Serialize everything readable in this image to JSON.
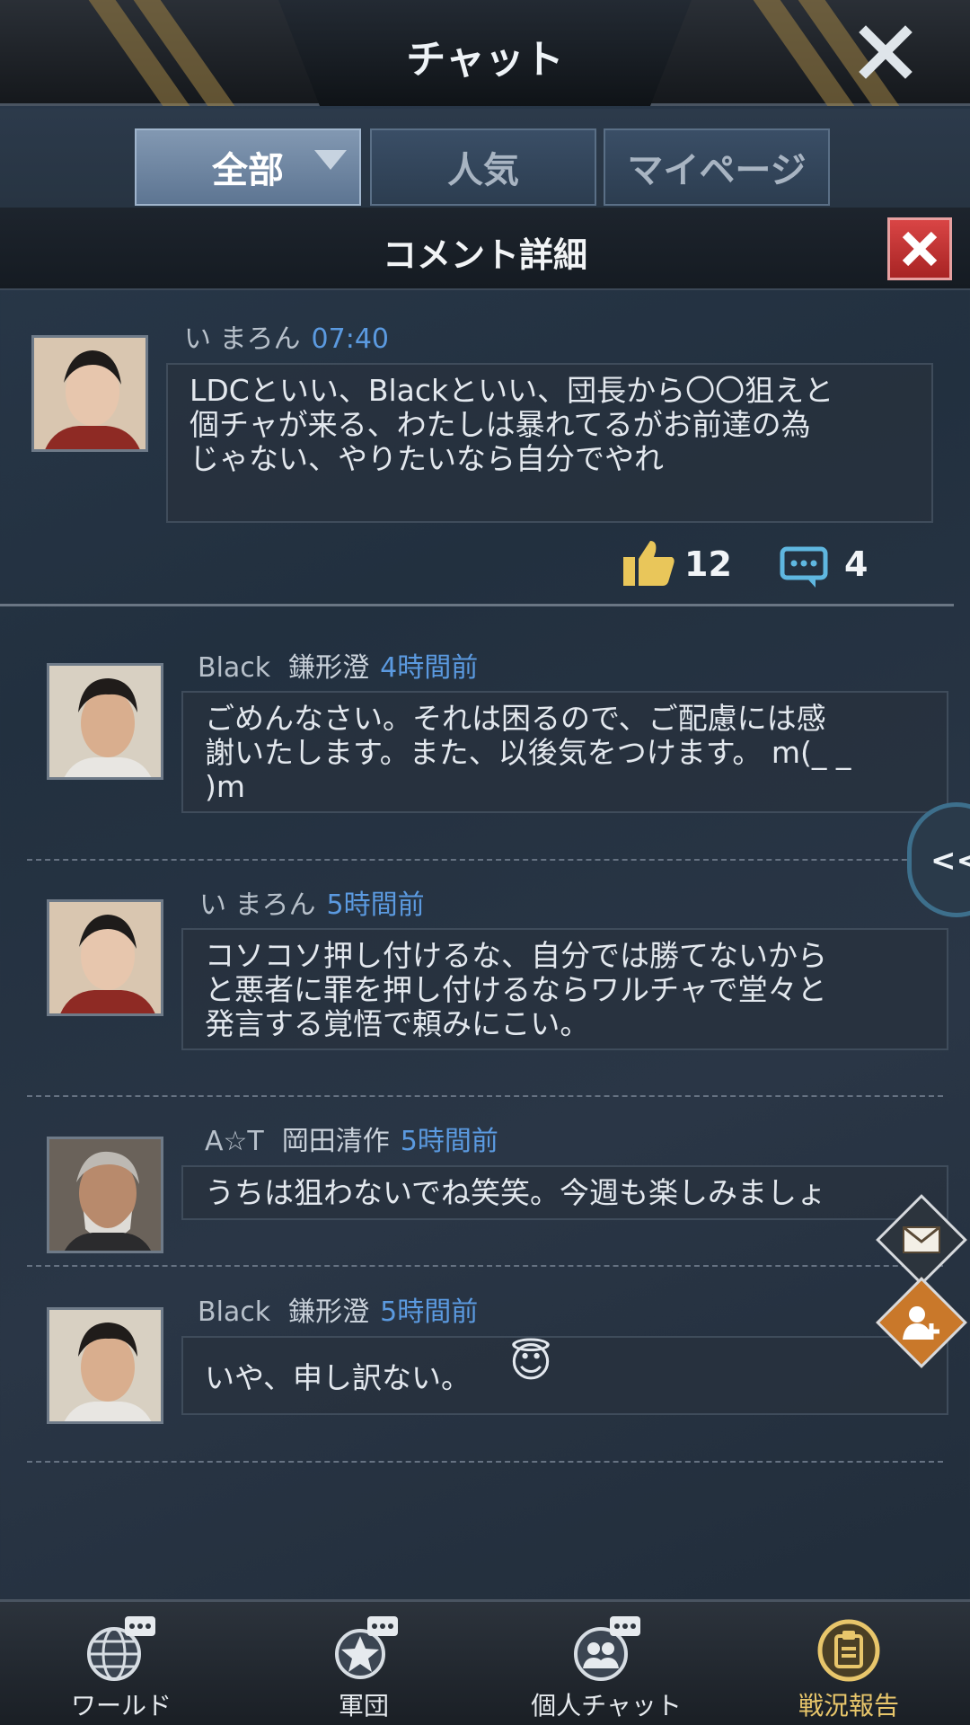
{
  "header": {
    "title": "チャット",
    "close_icon": "close-icon"
  },
  "tabs": [
    {
      "label": "全部",
      "active": true
    },
    {
      "label": "人気",
      "active": false
    },
    {
      "label": "マイページ",
      "active": false
    }
  ],
  "detail": {
    "title": "コメント詳細"
  },
  "post": {
    "author": "い まろん",
    "time": "07:40",
    "lines": [
      "LDCといい、Blackといい、団長から〇〇狙えと",
      "個チャが来る、わたしは暴れてるがお前達の為",
      "じゃない、やりたいなら自分でやれ"
    ],
    "likes": "12",
    "comments": "4"
  },
  "replies": [
    {
      "author": "Black",
      "name2": "鎌形澄",
      "time": "4時間前",
      "lines": [
        "ごめんなさい。それは困るので、ご配慮には感",
        "謝いたします。また、以後気をつけます。 m(_ _",
        ")m"
      ]
    },
    {
      "author": "い まろん",
      "name2": "",
      "time": "5時間前",
      "lines": [
        "コソコソ押し付けるな、自分では勝てないから",
        "と悪者に罪を押し付けるならワルチャで堂々と",
        "発言する覚悟で頼みにこい。"
      ]
    },
    {
      "author": "A☆T",
      "name2": "岡田清作",
      "time": "5時間前",
      "lines": [
        "うちは狙わないでね笑笑。今週も楽しみましょ"
      ]
    },
    {
      "author": "Black",
      "name2": "鎌形澄",
      "time": "5時間前",
      "lines": [
        "いや、申し訳ない。"
      ],
      "emoji": "😇"
    }
  ],
  "side": {
    "expand_label": "<<"
  },
  "nav": [
    {
      "label": "ワールド",
      "icon": "globe-chat-icon",
      "active": false
    },
    {
      "label": "軍団",
      "icon": "star-emblem-icon",
      "active": false
    },
    {
      "label": "個人チャット",
      "icon": "people-chat-icon",
      "active": false
    },
    {
      "label": "戦況報告",
      "icon": "report-icon",
      "active": true
    }
  ],
  "colors": {
    "accent_time": "#5b9ae0",
    "like": "#e9c65a",
    "comment": "#5fb7e0",
    "nav_active": "#e8c66b"
  }
}
